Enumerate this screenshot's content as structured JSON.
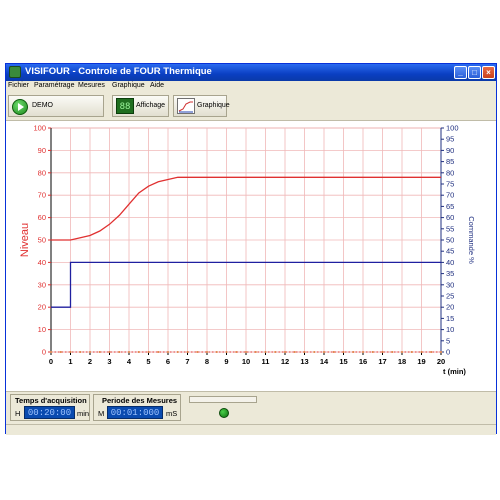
{
  "window": {
    "title": "VISIFOUR - Controle de FOUR Thermique",
    "buttons": {
      "minimize": "_",
      "maximize": "□",
      "close": "×"
    }
  },
  "menu": [
    "Fichier",
    "Paramétrage",
    "Mesures",
    "Graphique",
    "Aide"
  ],
  "toolbar": {
    "demo_label": "DEMO",
    "affichage_label": "Affichage",
    "affichage_icon_text": "88",
    "graphique_label": "Graphique"
  },
  "chart_data": {
    "type": "line",
    "xlabel": "t (min)",
    "ylabel": "Niveau",
    "y2label": "Commande %",
    "xlim": [
      0,
      20
    ],
    "ylim": [
      0,
      100
    ],
    "y2lim": [
      0,
      100
    ],
    "x_ticks": [
      0,
      1,
      2,
      3,
      4,
      5,
      6,
      7,
      8,
      9,
      10,
      11,
      12,
      13,
      14,
      15,
      16,
      17,
      18,
      19,
      20
    ],
    "y_ticks": [
      0,
      10,
      20,
      30,
      40,
      50,
      60,
      70,
      80,
      90,
      100
    ],
    "y2_ticks": [
      0,
      5,
      10,
      15,
      20,
      25,
      30,
      35,
      40,
      45,
      50,
      55,
      60,
      65,
      70,
      75,
      80,
      85,
      90,
      95,
      100
    ],
    "grid": true,
    "colors": {
      "niveau": "#e03030",
      "commande": "#2020a0",
      "grid": "#f0b8b8"
    },
    "series": [
      {
        "key": "niveau",
        "axis": "left",
        "x": [
          0,
          0.5,
          1,
          1.5,
          2,
          2.5,
          3,
          3.5,
          4,
          4.5,
          5,
          5.5,
          6,
          6.5,
          7,
          7.5,
          8,
          8.5,
          9,
          10,
          11,
          12,
          13,
          14,
          15,
          16,
          17,
          18,
          19,
          20
        ],
        "values": [
          50,
          50,
          50,
          51,
          52,
          54,
          57,
          61,
          66,
          71,
          74,
          76,
          77,
          78,
          78,
          78,
          78,
          78,
          78,
          78,
          78,
          78,
          78,
          78,
          78,
          78,
          78,
          78,
          78,
          78
        ]
      },
      {
        "key": "commande",
        "axis": "right",
        "x": [
          0,
          1,
          1,
          20
        ],
        "values": [
          20,
          20,
          40,
          40
        ]
      }
    ],
    "setpoint_markers_y": 0
  },
  "acquisition": {
    "label": "Temps d'acquisition",
    "prefix": "H",
    "value": "00:20:00",
    "unit": "min"
  },
  "periode": {
    "label": "Periode des Mesures",
    "prefix": "M",
    "value": "00:01:000",
    "unit": "mS"
  }
}
